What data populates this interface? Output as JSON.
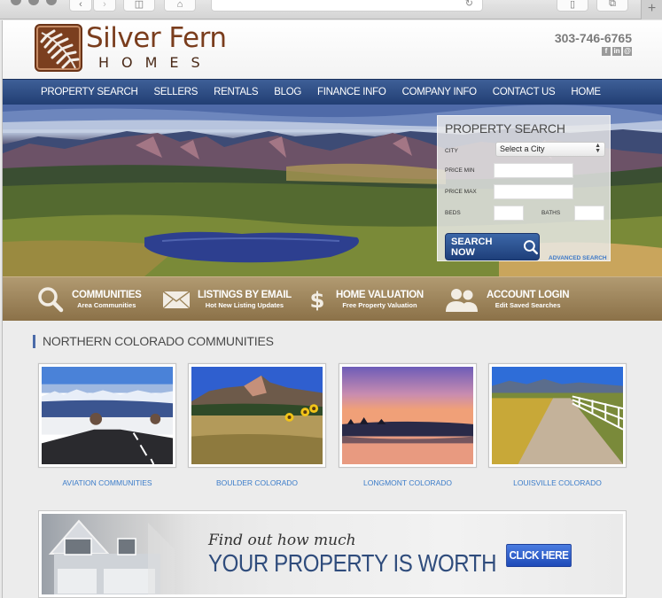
{
  "browser": {
    "back_icon": "chevron-left-icon",
    "forward_icon": "chevron-right-icon",
    "sidebar_icon": "sidebar-icon",
    "home_icon": "home-icon",
    "reload_icon": "reload-icon",
    "share_icon": "share-icon",
    "tabs_icon": "tabs-icon",
    "new_tab_label": "+"
  },
  "header": {
    "logo_title": "Silver Fern",
    "logo_subtitle": "HOMES",
    "phone": "303-746-6765",
    "social": [
      {
        "name": "facebook-icon",
        "glyph": "f"
      },
      {
        "name": "linkedin-icon",
        "glyph": "in"
      },
      {
        "name": "email-icon",
        "glyph": "@"
      }
    ]
  },
  "nav": {
    "items": [
      "PROPERTY SEARCH",
      "SELLERS",
      "RENTALS",
      "BLOG",
      "FINANCE INFO",
      "COMPANY INFO",
      "CONTACT US",
      "HOME"
    ]
  },
  "property_search": {
    "title": "PROPERTY SEARCH",
    "city_label": "CITY",
    "city_value": "Select a City",
    "price_min_label": "PRICE MIN",
    "price_min_value": "",
    "price_max_label": "PRICE MAX",
    "price_max_value": "",
    "beds_label": "BEDS",
    "beds_value": "",
    "baths_label": "BATHS",
    "baths_value": "",
    "search_button": "SEARCH NOW",
    "advanced_link": "ADVANCED SEARCH"
  },
  "features": [
    {
      "title": "COMMUNITIES",
      "subtitle": "Area Communities",
      "icon": "search-icon"
    },
    {
      "title": "LISTINGS BY EMAIL",
      "subtitle": "Hot New Listing Updates",
      "icon": "envelope-icon"
    },
    {
      "title": "HOME VALUATION",
      "subtitle": "Free Property Valuation",
      "icon": "dollar-icon"
    },
    {
      "title": "ACCOUNT LOGIN",
      "subtitle": "Edit Saved Searches",
      "icon": "users-icon"
    }
  ],
  "communities": {
    "title": "NORTHERN COLORADO COMMUNITIES",
    "items": [
      {
        "label": "AVIATION COMMUNITIES",
        "image": "snowy mountain road"
      },
      {
        "label": "BOULDER COLORADO",
        "image": "flatirons with sunflowers"
      },
      {
        "label": "LONGMONT COLORADO",
        "image": "sunset over lake"
      },
      {
        "label": "LOUISVILLE COLORADO",
        "image": "trail with white fence"
      }
    ]
  },
  "banner": {
    "line1": "Find out how much",
    "line2": "YOUR PROPERTY IS WORTH",
    "button": "CLICK HERE"
  },
  "colors": {
    "nav_blue": "#2c4a82",
    "brand_brown": "#7a3d1d",
    "feature_bar": "#9c8459",
    "link_blue": "#3b7cc9"
  }
}
